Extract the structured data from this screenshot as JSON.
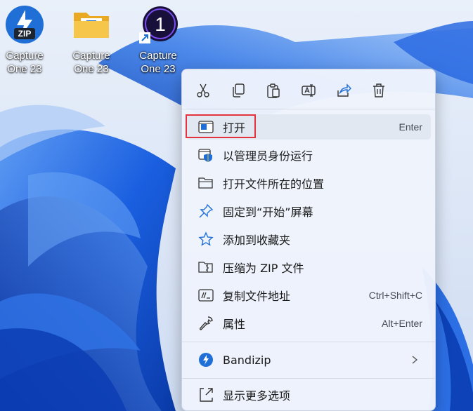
{
  "desktop": {
    "icons": [
      {
        "label": "Capture\nOne 23",
        "icon": "bandizip-zip-icon"
      },
      {
        "label": "Capture\nOne 23",
        "icon": "folder-icon"
      },
      {
        "label": "Capture\nOne 23",
        "icon": "capture-one-icon"
      }
    ],
    "zip_badge": "ZIP",
    "capture_one_glyph": "1"
  },
  "context_menu": {
    "quick_actions": [
      {
        "name": "cut",
        "icon": "scissors-icon"
      },
      {
        "name": "copy",
        "icon": "copy-icon"
      },
      {
        "name": "paste",
        "icon": "clipboard-icon"
      },
      {
        "name": "rename",
        "icon": "rename-icon"
      },
      {
        "name": "share",
        "icon": "share-icon"
      },
      {
        "name": "delete",
        "icon": "trash-icon"
      }
    ],
    "items": [
      {
        "label": "打开",
        "shortcut": "Enter",
        "icon": "open-window-icon"
      },
      {
        "label": "以管理员身份运行",
        "shortcut": "",
        "icon": "shield-icon"
      },
      {
        "label": "打开文件所在的位置",
        "shortcut": "",
        "icon": "folder-outline-icon"
      },
      {
        "label": "固定到“开始”屏幕",
        "shortcut": "",
        "icon": "pin-icon"
      },
      {
        "label": "添加到收藏夹",
        "shortcut": "",
        "icon": "star-icon"
      },
      {
        "label": "压缩为 ZIP 文件",
        "shortcut": "",
        "icon": "zip-folder-icon"
      },
      {
        "label": "复制文件地址",
        "shortcut": "Ctrl+Shift+C",
        "icon": "copy-path-icon"
      },
      {
        "label": "属性",
        "shortcut": "Alt+Enter",
        "icon": "wrench-icon"
      },
      {
        "label": "Bandizip",
        "shortcut": "",
        "icon": "bandizip-icon"
      },
      {
        "label": "显示更多选项",
        "shortcut": "",
        "icon": "show-more-icon"
      }
    ]
  },
  "colors": {
    "accent": "#1f6fd6",
    "highlight_border": "#e5333d",
    "wallpaper_blue": "#1556d8"
  }
}
